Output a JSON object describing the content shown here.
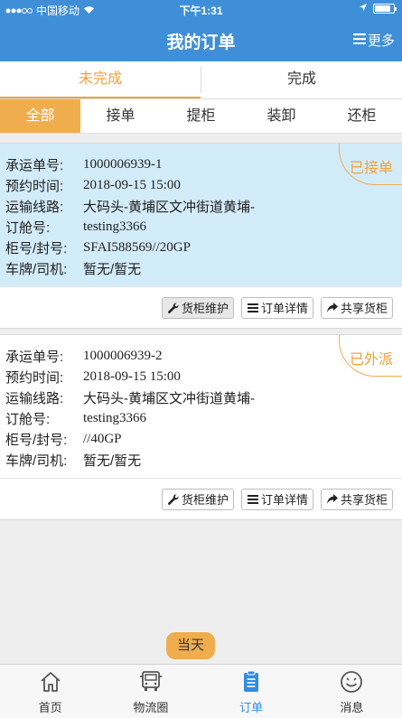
{
  "status_bar": {
    "carrier": "中国移动",
    "time": "下午1:31"
  },
  "header": {
    "title": "我的订单",
    "more_label": "更多"
  },
  "segments": [
    {
      "label": "未完成",
      "active": true
    },
    {
      "label": "完成",
      "active": false
    }
  ],
  "categories": [
    {
      "label": "全部",
      "active": true
    },
    {
      "label": "接单",
      "active": false
    },
    {
      "label": "提柜",
      "active": false
    },
    {
      "label": "装卸",
      "active": false
    },
    {
      "label": "还柜",
      "active": false
    }
  ],
  "field_labels": {
    "order_no": "承运单号:",
    "appointment": "预约时间:",
    "route": "运输线路:",
    "booking": "订舱号:",
    "container": "柜号/封号:",
    "plate_driver": "车牌/司机:"
  },
  "orders": [
    {
      "order_no": "1000006939-1",
      "appointment": "2018-09-15 15:00",
      "route": "大码头-黄埔区文冲街道黄埔-",
      "booking": "testing3366",
      "container": "SFAI588569//20GP",
      "plate_driver": "暂无/暂无",
      "status": "已接单",
      "highlight": true
    },
    {
      "order_no": "1000006939-2",
      "appointment": "2018-09-15 15:00",
      "route": "大码头-黄埔区文冲街道黄埔-",
      "booking": "testing3366",
      "container": "//40GP",
      "plate_driver": "暂无/暂无",
      "status": "已外派",
      "highlight": false
    }
  ],
  "actions": {
    "maintain": "货柜维护",
    "detail": "订单详情",
    "share": "共享货柜"
  },
  "today_label": "当天",
  "tabbar": [
    {
      "label": "首页",
      "icon": "home-icon",
      "active": false
    },
    {
      "label": "物流圈",
      "icon": "truck-icon",
      "active": false
    },
    {
      "label": "订单",
      "icon": "clipboard-icon",
      "active": true
    },
    {
      "label": "消息",
      "icon": "smiley-icon",
      "active": false
    }
  ],
  "colors": {
    "brand_blue": "#3f8fd8",
    "accent_orange": "#f0ad4e",
    "highlight_bg": "#d3ecfa",
    "tab_active": "#2f8de4"
  }
}
